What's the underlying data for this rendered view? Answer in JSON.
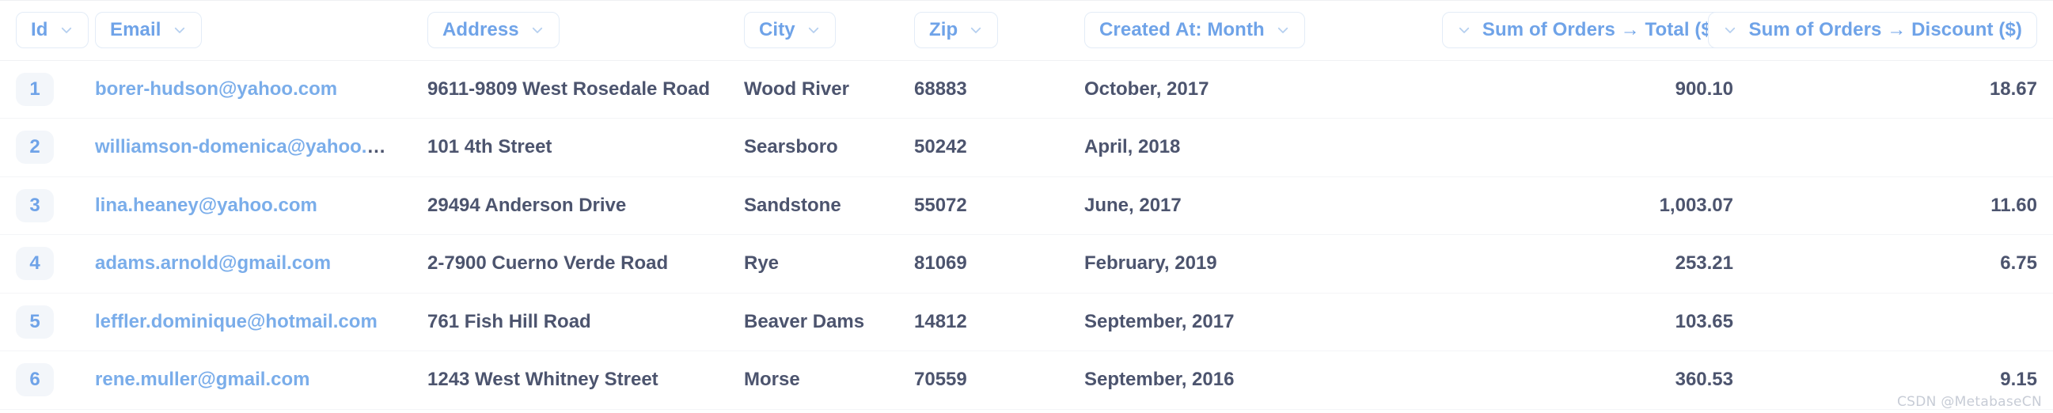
{
  "table": {
    "columns": [
      {
        "key": "id",
        "label": "Id",
        "align": "left",
        "chevron": "right",
        "class": "c-id"
      },
      {
        "key": "email",
        "label": "Email",
        "align": "left",
        "chevron": "right",
        "class": "c-email"
      },
      {
        "key": "address",
        "label": "Address",
        "align": "left",
        "chevron": "right",
        "class": "c-address"
      },
      {
        "key": "city",
        "label": "City",
        "align": "left",
        "chevron": "right",
        "class": "c-city"
      },
      {
        "key": "zip",
        "label": "Zip",
        "align": "left",
        "chevron": "right",
        "class": "c-zip"
      },
      {
        "key": "created",
        "label": "Created At: Month",
        "align": "left",
        "chevron": "right",
        "class": "c-created"
      },
      {
        "key": "total",
        "label": "Sum of Orders → Total ($)",
        "align": "right",
        "chevron": "left",
        "class": "c-total"
      },
      {
        "key": "discount",
        "label": "Sum of Orders → Discount ($)",
        "align": "right",
        "chevron": "left",
        "class": "c-discount"
      }
    ],
    "rows": [
      {
        "id": "1",
        "email": "borer-hudson@yahoo.com",
        "address": "9611-9809 West Rosedale Road",
        "city": "Wood River",
        "zip": "68883",
        "created": "October, 2017",
        "total": "900.10",
        "discount": "18.67"
      },
      {
        "id": "2",
        "email": "williamson-domenica@yahoo.com",
        "address": "101 4th Street",
        "city": "Searsboro",
        "zip": "50242",
        "created": "April, 2018",
        "total": "",
        "discount": ""
      },
      {
        "id": "3",
        "email": "lina.heaney@yahoo.com",
        "address": "29494 Anderson Drive",
        "city": "Sandstone",
        "zip": "55072",
        "created": "June, 2017",
        "total": "1,003.07",
        "discount": "11.60"
      },
      {
        "id": "4",
        "email": "adams.arnold@gmail.com",
        "address": "2-7900 Cuerno Verde Road",
        "city": "Rye",
        "zip": "81069",
        "created": "February, 2019",
        "total": "253.21",
        "discount": "6.75"
      },
      {
        "id": "5",
        "email": "leffler.dominique@hotmail.com",
        "address": "761 Fish Hill Road",
        "city": "Beaver Dams",
        "zip": "14812",
        "created": "September, 2017",
        "total": "103.65",
        "discount": ""
      },
      {
        "id": "6",
        "email": "rene.muller@gmail.com",
        "address": "1243 West Whitney Street",
        "city": "Morse",
        "zip": "70559",
        "created": "September, 2016",
        "total": "360.53",
        "discount": "9.15"
      }
    ]
  },
  "watermark": {
    "text": "CSDN @MetabaseCN"
  },
  "colors": {
    "header_text": "#6fa3e8",
    "header_border": "#e3ecf7",
    "cell_text": "#4c546e",
    "link_text": "#7aadea",
    "id_pill_bg": "#f3f6fa",
    "row_divider": "#f4f5f7",
    "background": "#ffffff"
  }
}
